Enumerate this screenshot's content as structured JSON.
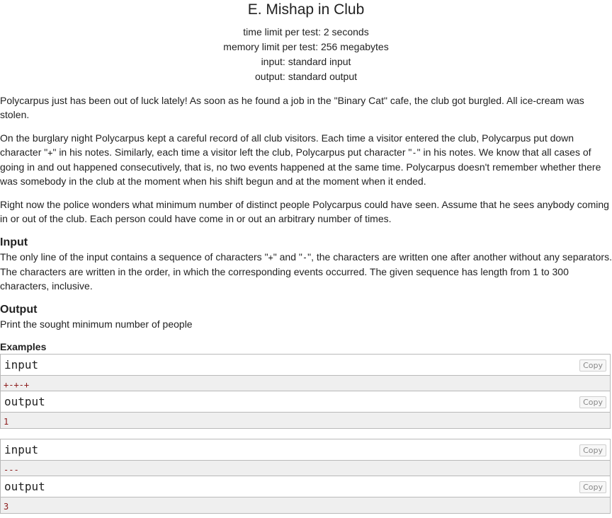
{
  "problem": {
    "title": "E. Mishap in Club",
    "time_limit": "time limit per test: 2 seconds",
    "memory_limit": "memory limit per test: 256 megabytes",
    "input_file": "input: standard input",
    "output_file": "output: standard output"
  },
  "legend": {
    "p1": "Polycarpus just has been out of luck lately! As soon as he found a job in the \"Binary Cat\" cafe, the club got burgled. All ice-cream was stolen.",
    "p2_a": "On the burglary night Polycarpus kept a careful record of all club visitors. Each time a visitor entered the club, Polycarpus put down character \"",
    "p2_plus": "+",
    "p2_b": "\" in his notes. Similarly, each time a visitor left the club, Polycarpus put character \"",
    "p2_minus": "-",
    "p2_c": "\" in his notes. We know that all cases of going in and out happened consecutively, that is, no two events happened at the same time. Polycarpus doesn't remember whether there was somebody in the club at the moment when his shift begun and at the moment when it ended.",
    "p3": "Right now the police wonders what minimum number of distinct people Polycarpus could have seen. Assume that he sees anybody coming in or out of the club. Each person could have come in or out an arbitrary number of times."
  },
  "input_spec": {
    "title": "Input",
    "text_a": "The only line of the input contains a sequence of characters \"",
    "plus": "+",
    "text_b": "\" and \"",
    "minus": "-",
    "text_c": "\", the characters are written one after another without any separators. The characters are written in the order, in which the corresponding events occurred. The given sequence has length from 1 to 300 characters, inclusive."
  },
  "output_spec": {
    "title": "Output",
    "text": "Print the sought minimum number of people"
  },
  "examples": {
    "title": "Examples",
    "copy_label": "Copy",
    "input_label": "input",
    "output_label": "output",
    "items": [
      {
        "input": "+-+-+",
        "output": "1"
      },
      {
        "input": "---",
        "output": "3"
      }
    ]
  }
}
